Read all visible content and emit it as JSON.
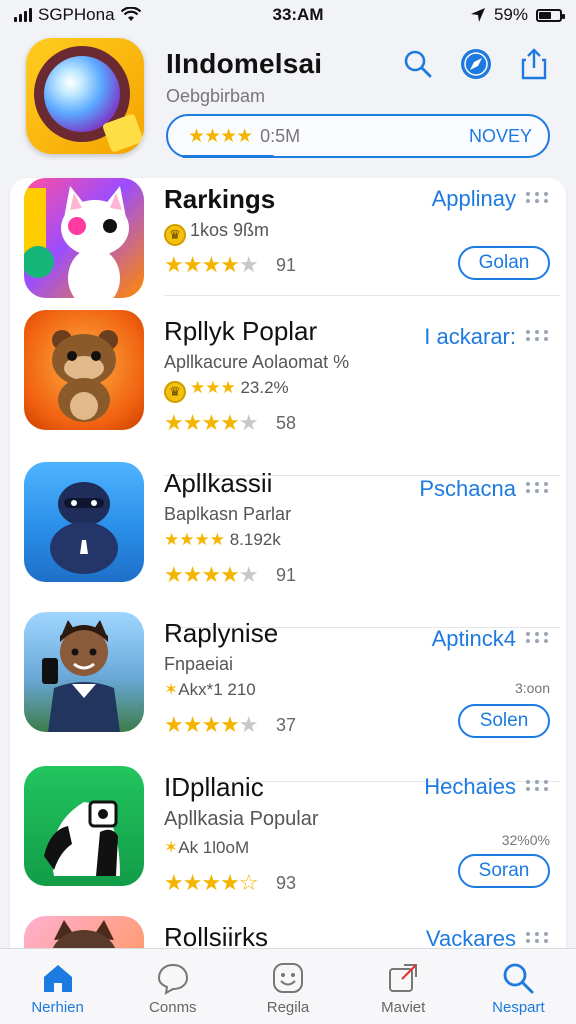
{
  "status_bar": {
    "carrier": "SGPHona",
    "time": "33:AM",
    "battery": "59%",
    "battery_level": 0.59
  },
  "header": {
    "title": "IIndomelsai",
    "subtitle": "Oebgbirbam",
    "rating_count": "0:5M",
    "action": "NOVEY",
    "stars": "★★★★"
  },
  "apps": [
    {
      "name": "Rarkings",
      "subtitle": "1kos 9ßm",
      "category": "Applinay",
      "stars": "★★★★",
      "rating": "91",
      "button": "Golan"
    },
    {
      "name": "Rpllyk Poplar",
      "subtitle": "Apllkacure Aolaomat %",
      "subtitle2": "23.2%",
      "category": "I ackarar:",
      "stars": "★★★★",
      "rating": "58"
    },
    {
      "name": "Apllkassii",
      "subtitle": "Baplkasn Parlar",
      "subtitle2": "8.192k",
      "category": "Pschacna",
      "stars": "★★★★",
      "rating": "91"
    },
    {
      "name": "Raplynise",
      "subtitle": "Fnpaeiai",
      "subtitle2": "Akx*1 210",
      "category": "Aptinck4",
      "stars": "★★★★",
      "rating": "37",
      "side_note": "3:oon",
      "button": "Solen"
    },
    {
      "name": "IDpllanic",
      "subtitle": "Apllkasia Popular",
      "subtitle2": "Ak 1l0oM",
      "category": "Hechaies",
      "stars": "★★★★",
      "rating": "93",
      "side_note": "32%0%",
      "button": "Soran"
    },
    {
      "name": "Rollsiirks",
      "category": "Vackares"
    }
  ],
  "tabs": [
    {
      "label": "Nerhien",
      "icon": "home-icon",
      "active": true
    },
    {
      "label": "Conms",
      "icon": "chat-icon",
      "active": false
    },
    {
      "label": "Regila",
      "icon": "emoji-icon",
      "active": false
    },
    {
      "label": "Maviet",
      "icon": "share-box-icon",
      "active": false
    },
    {
      "label": "Nespart",
      "icon": "search-icon",
      "active": true
    }
  ],
  "colors": {
    "accent": "#1d7ae0",
    "star": "#f4b400",
    "background": "#f2f3f7"
  }
}
